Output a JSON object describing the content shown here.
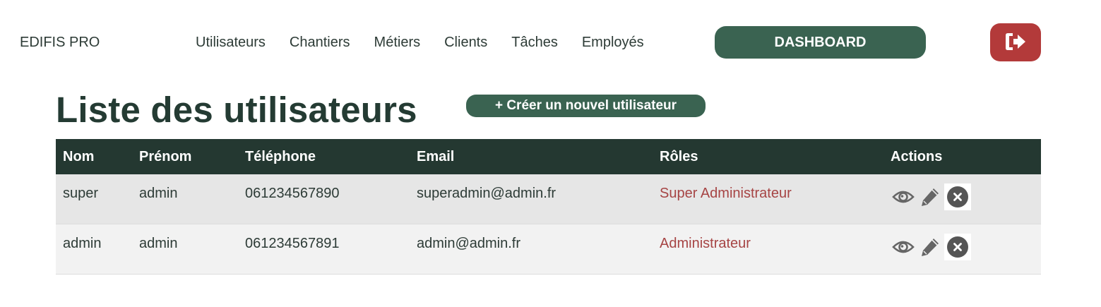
{
  "brand": "EDIFIS PRO",
  "nav": {
    "items": [
      "Utilisateurs",
      "Chantiers",
      "Métiers",
      "Clients",
      "Tâches",
      "Employés"
    ],
    "dashboard_label": "DASHBOARD",
    "logout_icon": "logout-icon"
  },
  "page": {
    "title": "Liste des utilisateurs",
    "create_label": "+ Créer un nouvel utilisateur"
  },
  "table": {
    "headers": {
      "nom": "Nom",
      "prenom": "Prénom",
      "telephone": "Téléphone",
      "email": "Email",
      "roles": "Rôles",
      "actions": "Actions"
    },
    "rows": [
      {
        "nom": "super",
        "prenom": "admin",
        "telephone": "061234567890",
        "email": "superadmin@admin.fr",
        "role": "Super Administrateur"
      },
      {
        "nom": "admin",
        "prenom": "admin",
        "telephone": "061234567891",
        "email": "admin@admin.fr",
        "role": "Administrateur"
      }
    ],
    "action_icons": [
      "eye-icon",
      "pencil-icon",
      "close-circle-icon"
    ]
  },
  "colors": {
    "primary": "#3a6351",
    "header_bg": "#243831",
    "danger": "#b33a3a",
    "role_text": "#a64444"
  }
}
